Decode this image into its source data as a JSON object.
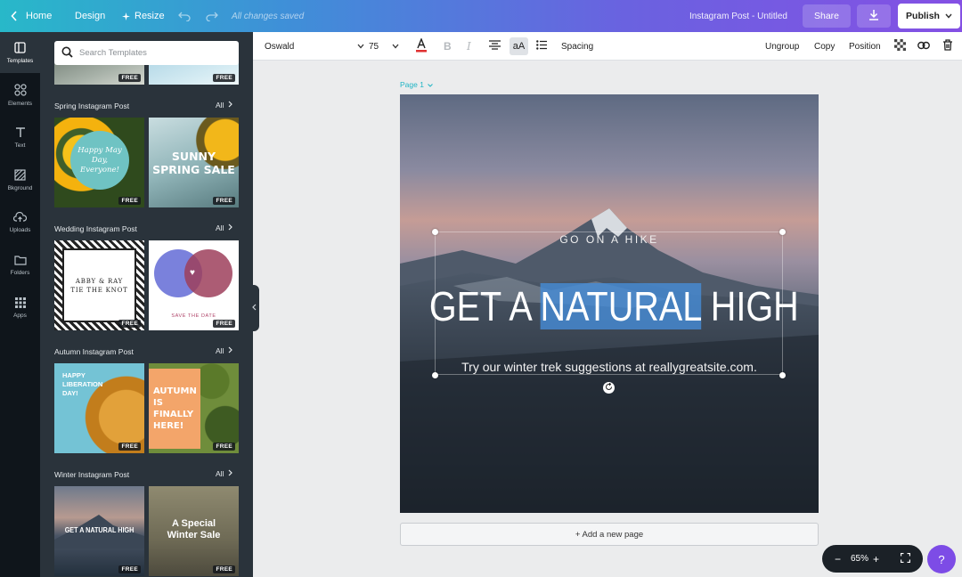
{
  "topbar": {
    "home_label": "Home",
    "design_label": "Design",
    "resize_label": "Resize",
    "saved_status": "All changes saved",
    "doc_title": "Instagram Post - Untitled",
    "share_label": "Share",
    "publish_label": "Publish",
    "icons": [
      "chevron-left-icon",
      "sparkle-icon",
      "undo-icon",
      "redo-icon",
      "download-icon",
      "chevron-down-icon"
    ]
  },
  "rail": {
    "items": [
      {
        "label": "Templates",
        "icon": "templates-icon"
      },
      {
        "label": "Elements",
        "icon": "elements-icon"
      },
      {
        "label": "Text",
        "icon": "text-icon"
      },
      {
        "label": "Bkground",
        "icon": "background-icon"
      },
      {
        "label": "Uploads",
        "icon": "upload-icon"
      },
      {
        "label": "Folders",
        "icon": "folder-icon"
      },
      {
        "label": "Apps",
        "icon": "apps-icon"
      }
    ]
  },
  "panel": {
    "search_placeholder": "Search Templates",
    "all_label": "All",
    "free_badge": "FREE",
    "sections": [
      {
        "title": "Spring Instagram Post",
        "thumbs": [
          {
            "lines": [
              "Happy May Day,",
              "Everyone!"
            ]
          },
          {
            "lines": [
              "SUNNY",
              "SPRING SALE"
            ]
          }
        ]
      },
      {
        "title": "Wedding Instagram Post",
        "thumbs": [
          {
            "lines": [
              "ABBY & RAY",
              "TIE THE KNOT"
            ]
          },
          {
            "lines": [
              "SAVE THE DATE"
            ]
          }
        ]
      },
      {
        "title": "Autumn Instagram Post",
        "thumbs": [
          {
            "lines": [
              "HAPPY",
              "LIBERATION",
              "DAY!"
            ]
          },
          {
            "lines": [
              "AUTUMN",
              "IS",
              "FINALLY",
              "HERE!"
            ]
          }
        ]
      },
      {
        "title": "Winter Instagram Post",
        "thumbs": [
          {
            "lines": [
              "GET A NATURAL HIGH"
            ]
          },
          {
            "lines": [
              "A Special",
              "Winter Sale"
            ]
          }
        ]
      }
    ]
  },
  "toolbar": {
    "font_family": "Oswald",
    "font_size": "75",
    "case_label": "aA",
    "spacing_label": "Spacing",
    "ungroup_label": "Ungroup",
    "copy_label": "Copy",
    "position_label": "Position",
    "text_color": "#e03131"
  },
  "canvas": {
    "page_label": "Page 1",
    "eyebrow": "GO ON A HIKE",
    "headline_before": "GET A ",
    "headline_selected": "NATURAL",
    "headline_after": " HIGH",
    "subline": "Try our winter trek suggestions at reallygreatsite.com.",
    "add_page_label": "+ Add a new page"
  },
  "zoom": {
    "level": "65%",
    "minus": "−",
    "plus": "+"
  },
  "help": {
    "label": "?"
  }
}
